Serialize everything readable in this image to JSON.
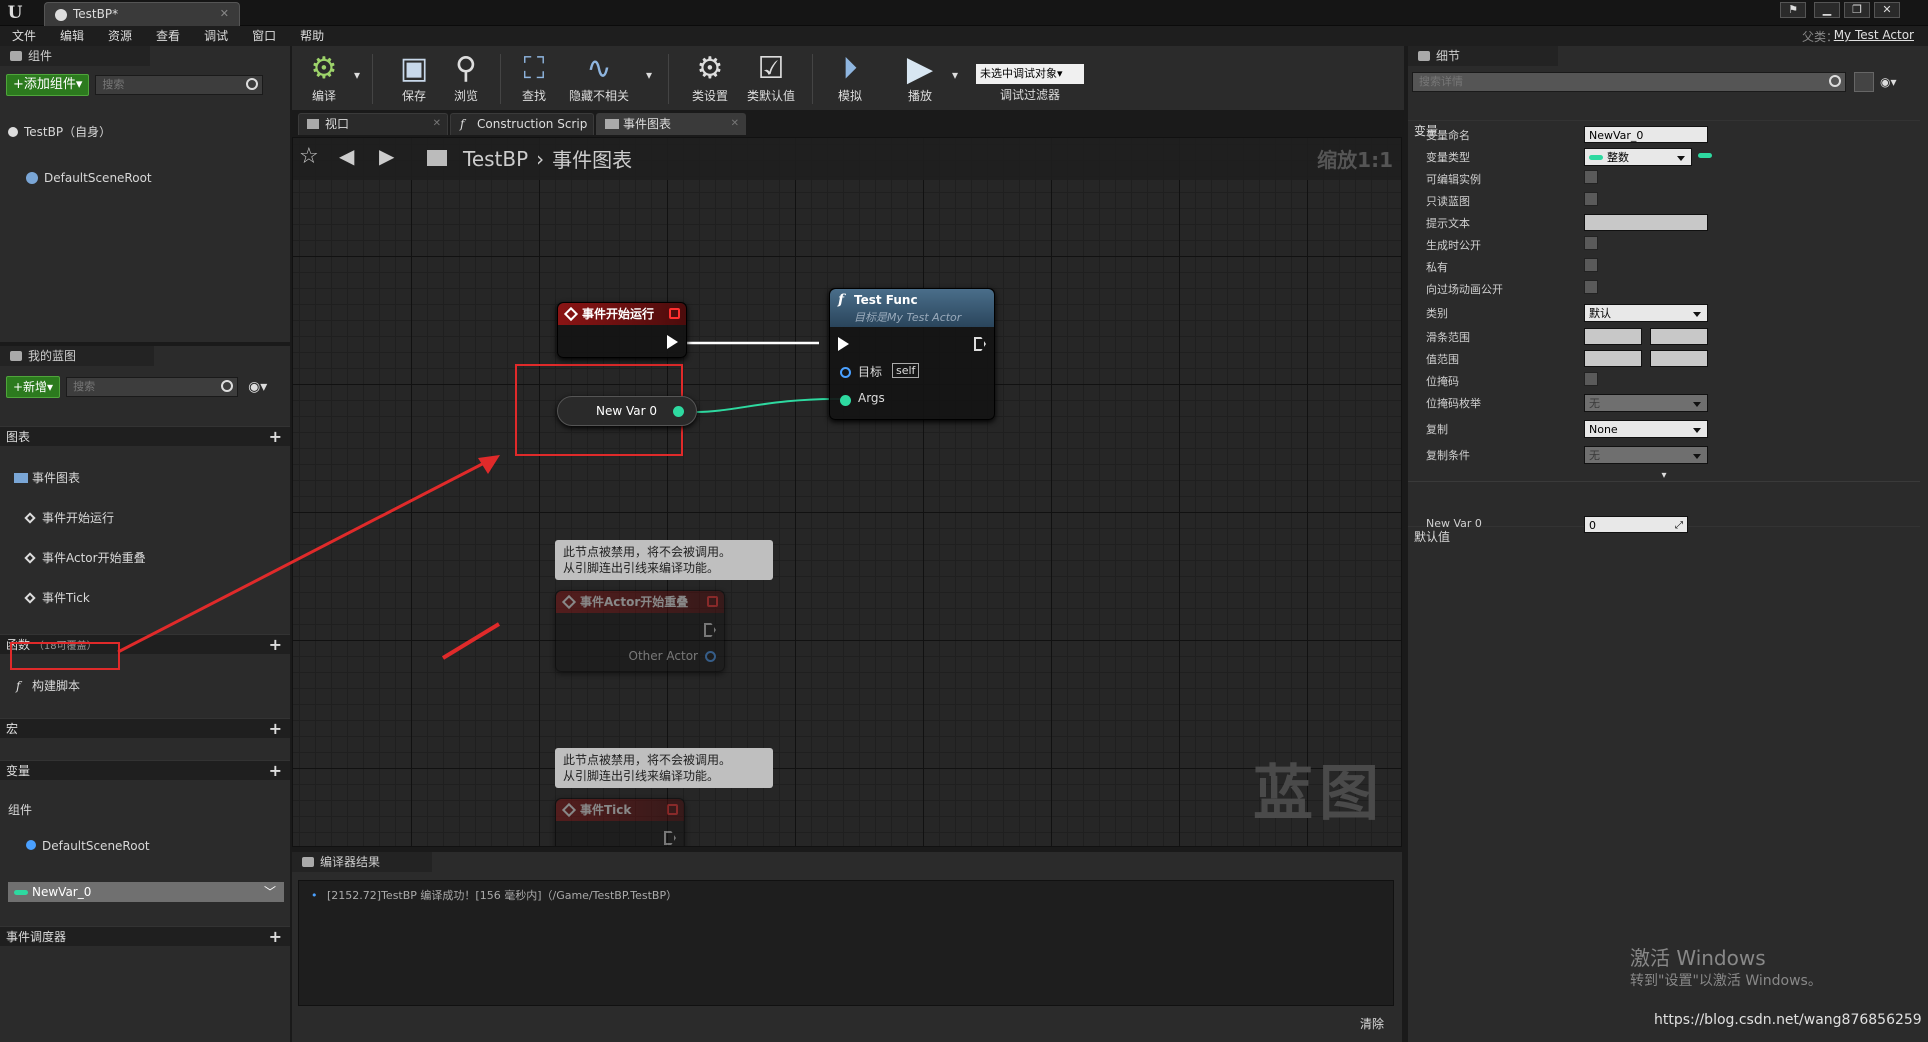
{
  "titlebar": {
    "tab_title": "TestBP*",
    "parent_label": "父类：",
    "parent_value": "My Test Actor"
  },
  "menu": [
    "文件",
    "编辑",
    "资源",
    "查看",
    "调试",
    "窗口",
    "帮助"
  ],
  "components_panel": {
    "tab": "组件",
    "add_button": "+添加组件▾",
    "search_placeholder": "搜索",
    "items": [
      "TestBP（自身）",
      "DefaultSceneRoot"
    ]
  },
  "my_blueprint": {
    "tab": "我的蓝图",
    "new_button": "+新增▾",
    "search_placeholder": "搜索",
    "graphs_header": "图表",
    "event_graph": "事件图表",
    "events": [
      "事件开始运行",
      "事件Actor开始重叠",
      "事件Tick"
    ],
    "functions_header": "函数",
    "functions_note": "（18可覆盖）",
    "construction": "构建脚本",
    "macros_header": "宏",
    "variables_header": "变量",
    "components_group": "组件",
    "component_var": "DefaultSceneRoot",
    "selected_var": "NewVar_0",
    "dispatchers_header": "事件调度器"
  },
  "toolbar": {
    "buttons": [
      "编译",
      "保存",
      "浏览",
      "查找",
      "隐藏不相关",
      "类设置",
      "类默认值",
      "模拟",
      "播放"
    ],
    "debug_select": "未选中调试对象▾",
    "debug_label": "调试过滤器"
  },
  "editor_tabs": [
    "视口",
    "Construction Scrip",
    "事件图表"
  ],
  "graph": {
    "breadcrumb_root": "TestBP",
    "breadcrumb_sep": "›",
    "breadcrumb_leaf": "事件图表",
    "zoom": "缩放1:1",
    "watermark": "蓝图",
    "begin_play": "事件开始运行",
    "func_title": "Test Func",
    "func_sub": "目标是My Test Actor",
    "target_label": "目标",
    "self_label": "self",
    "args_label": "Args",
    "var_node": "New Var 0",
    "disabled_note": "此节点被禁用，将不会被调用。\n从引脚连出引线来编译功能。",
    "overlap_node": "事件Actor开始重叠",
    "other_actor": "Other Actor",
    "tick_node": "事件Tick"
  },
  "compiler": {
    "tab": "编译器结果",
    "line": "[2152.72]TestBP 编译成功！[156 毫秒内]（/Game/TestBP.TestBP）",
    "clear": "清除"
  },
  "details": {
    "tab": "细节",
    "search_placeholder": "搜索详情",
    "variable_section": "变量",
    "rows": {
      "name_label": "变量命名",
      "name_value": "NewVar_0",
      "type_label": "变量类型",
      "type_value": "整数",
      "editable_label": "可编辑实例",
      "readonly_label": "只读蓝图",
      "tooltip_label": "提示文本",
      "expose_label": "生成时公开",
      "private_label": "私有",
      "cinematic_label": "向过场动画公开",
      "category_label": "类别",
      "category_value": "默认",
      "slider_label": "滑条范围",
      "value_range_label": "值范围",
      "bitmask_label": "位掩码",
      "bitmask_enum_label": "位掩码枚举",
      "bitmask_enum_value": "无",
      "replication_label": "复制",
      "replication_value": "None",
      "rep_condition_label": "复制条件",
      "rep_condition_value": "无"
    },
    "default_section": "默认值",
    "default_label": "New Var 0",
    "default_value": "0"
  },
  "overlay": {
    "win_activate": "激活 Windows",
    "win_activate_sub": "转到\"设置\"以激活 Windows。",
    "csdn": "https://blog.csdn.net/wang876856259"
  },
  "colors": {
    "accent_red": "#e02a2a",
    "int_green": "#2ed9a0",
    "add_green": "#2c7a1e"
  }
}
